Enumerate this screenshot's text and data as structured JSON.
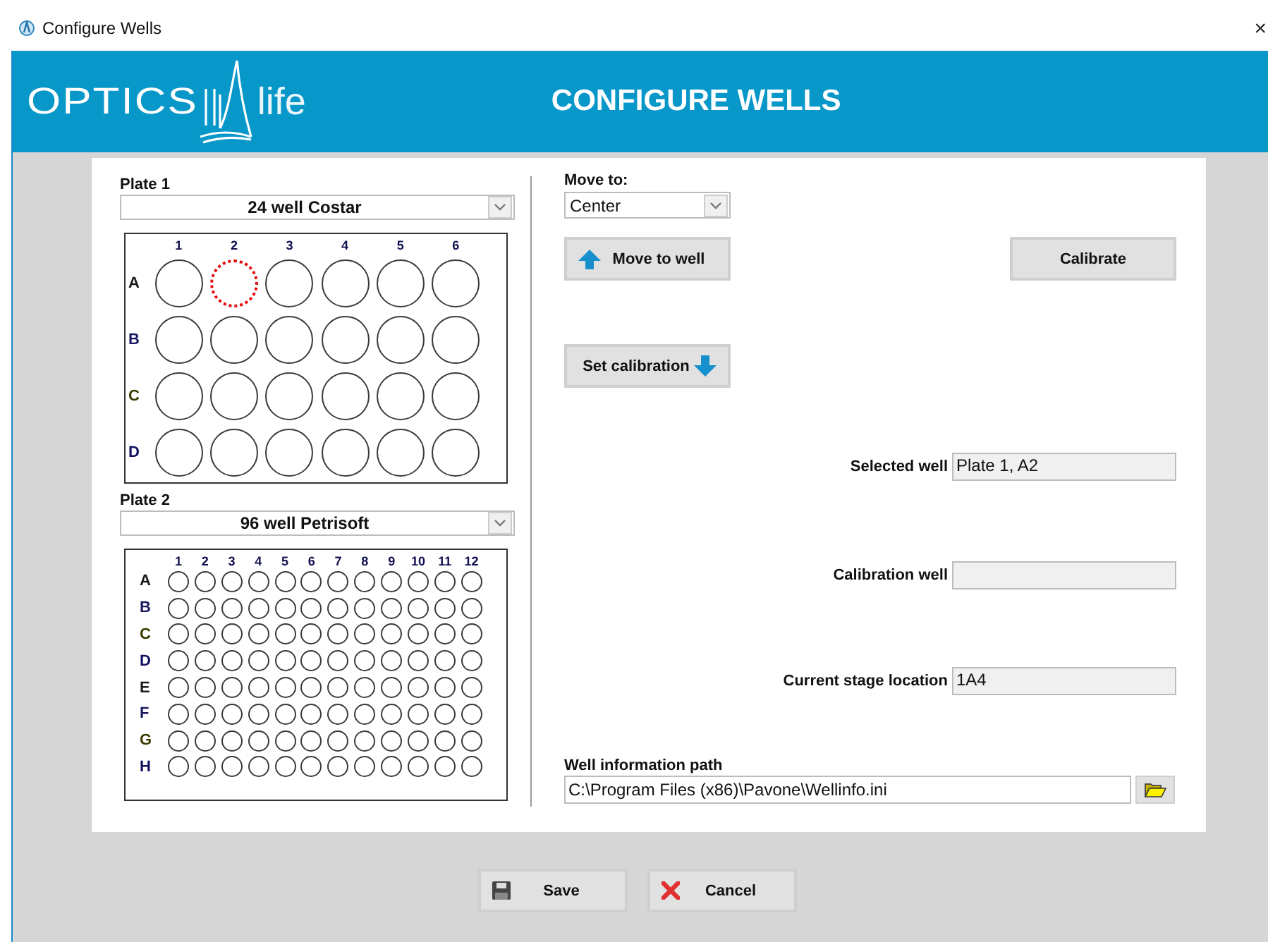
{
  "window": {
    "title": "Configure Wells",
    "close": "×"
  },
  "header": {
    "logo": {
      "left": "OPTICS",
      "right": "life"
    },
    "title": "CONFIGURE WELLS"
  },
  "plates": [
    {
      "label": "Plate 1",
      "type": "24 well Costar",
      "columns": [
        "1",
        "2",
        "3",
        "4",
        "5",
        "6"
      ],
      "rows": [
        {
          "label": "A",
          "wells": [
            {
              "selected": false
            },
            {
              "selected": true
            },
            {
              "selected": false
            },
            {
              "selected": false
            },
            {
              "selected": false
            },
            {
              "selected": false
            }
          ]
        },
        {
          "label": "B",
          "wells": [
            {
              "selected": false
            },
            {
              "selected": false
            },
            {
              "selected": false
            },
            {
              "selected": false
            },
            {
              "selected": false
            },
            {
              "selected": false
            }
          ]
        },
        {
          "label": "C",
          "wells": [
            {
              "selected": false
            },
            {
              "selected": false
            },
            {
              "selected": false
            },
            {
              "selected": false
            },
            {
              "selected": false
            },
            {
              "selected": false
            }
          ]
        },
        {
          "label": "D",
          "wells": [
            {
              "selected": false
            },
            {
              "selected": false
            },
            {
              "selected": false
            },
            {
              "selected": false
            },
            {
              "selected": false
            },
            {
              "selected": false
            }
          ]
        }
      ]
    },
    {
      "label": "Plate 2",
      "type": "96 well Petrisoft",
      "columns": [
        "1",
        "2",
        "3",
        "4",
        "5",
        "6",
        "7",
        "8",
        "9",
        "10",
        "11",
        "12"
      ],
      "rows": [
        {
          "label": "A",
          "wells": [
            {
              "selected": false
            },
            {
              "selected": false
            },
            {
              "selected": false
            },
            {
              "selected": false
            },
            {
              "selected": false
            },
            {
              "selected": false
            },
            {
              "selected": false
            },
            {
              "selected": false
            },
            {
              "selected": false
            },
            {
              "selected": false
            },
            {
              "selected": false
            },
            {
              "selected": false
            }
          ]
        },
        {
          "label": "B",
          "wells": [
            {
              "selected": false
            },
            {
              "selected": false
            },
            {
              "selected": false
            },
            {
              "selected": false
            },
            {
              "selected": false
            },
            {
              "selected": false
            },
            {
              "selected": false
            },
            {
              "selected": false
            },
            {
              "selected": false
            },
            {
              "selected": false
            },
            {
              "selected": false
            },
            {
              "selected": false
            }
          ]
        },
        {
          "label": "C",
          "wells": [
            {
              "selected": false
            },
            {
              "selected": false
            },
            {
              "selected": false
            },
            {
              "selected": false
            },
            {
              "selected": false
            },
            {
              "selected": false
            },
            {
              "selected": false
            },
            {
              "selected": false
            },
            {
              "selected": false
            },
            {
              "selected": false
            },
            {
              "selected": false
            },
            {
              "selected": false
            }
          ]
        },
        {
          "label": "D",
          "wells": [
            {
              "selected": false
            },
            {
              "selected": false
            },
            {
              "selected": false
            },
            {
              "selected": false
            },
            {
              "selected": false
            },
            {
              "selected": false
            },
            {
              "selected": false
            },
            {
              "selected": false
            },
            {
              "selected": false
            },
            {
              "selected": false
            },
            {
              "selected": false
            },
            {
              "selected": false
            }
          ]
        },
        {
          "label": "E",
          "wells": [
            {
              "selected": false
            },
            {
              "selected": false
            },
            {
              "selected": false
            },
            {
              "selected": false
            },
            {
              "selected": false
            },
            {
              "selected": false
            },
            {
              "selected": false
            },
            {
              "selected": false
            },
            {
              "selected": false
            },
            {
              "selected": false
            },
            {
              "selected": false
            },
            {
              "selected": false
            }
          ]
        },
        {
          "label": "F",
          "wells": [
            {
              "selected": false
            },
            {
              "selected": false
            },
            {
              "selected": false
            },
            {
              "selected": false
            },
            {
              "selected": false
            },
            {
              "selected": false
            },
            {
              "selected": false
            },
            {
              "selected": false
            },
            {
              "selected": false
            },
            {
              "selected": false
            },
            {
              "selected": false
            },
            {
              "selected": false
            }
          ]
        },
        {
          "label": "G",
          "wells": [
            {
              "selected": false
            },
            {
              "selected": false
            },
            {
              "selected": false
            },
            {
              "selected": false
            },
            {
              "selected": false
            },
            {
              "selected": false
            },
            {
              "selected": false
            },
            {
              "selected": false
            },
            {
              "selected": false
            },
            {
              "selected": false
            },
            {
              "selected": false
            },
            {
              "selected": false
            }
          ]
        },
        {
          "label": "H",
          "wells": [
            {
              "selected": false
            },
            {
              "selected": false
            },
            {
              "selected": false
            },
            {
              "selected": false
            },
            {
              "selected": false
            },
            {
              "selected": false
            },
            {
              "selected": false
            },
            {
              "selected": false
            },
            {
              "selected": false
            },
            {
              "selected": false
            },
            {
              "selected": false
            },
            {
              "selected": false
            }
          ]
        }
      ]
    }
  ],
  "move_to": {
    "label": "Move to:",
    "value": "Center"
  },
  "buttons": {
    "move_to_well": "Move to well",
    "calibrate": "Calibrate",
    "set_calibration": "Set calibration"
  },
  "fields": [
    {
      "label": "Selected well",
      "value": "Plate 1, A2"
    },
    {
      "label": "Calibration well"
    },
    {
      "label": "Current stage location",
      "value": "1A4"
    }
  ],
  "well_information_path": {
    "label": "Well information path",
    "value": "C:\\Program Files (x86)\\Pavone\\Wellinfo.ini"
  },
  "footer": {
    "save": "Save",
    "cancel": "Cancel"
  }
}
